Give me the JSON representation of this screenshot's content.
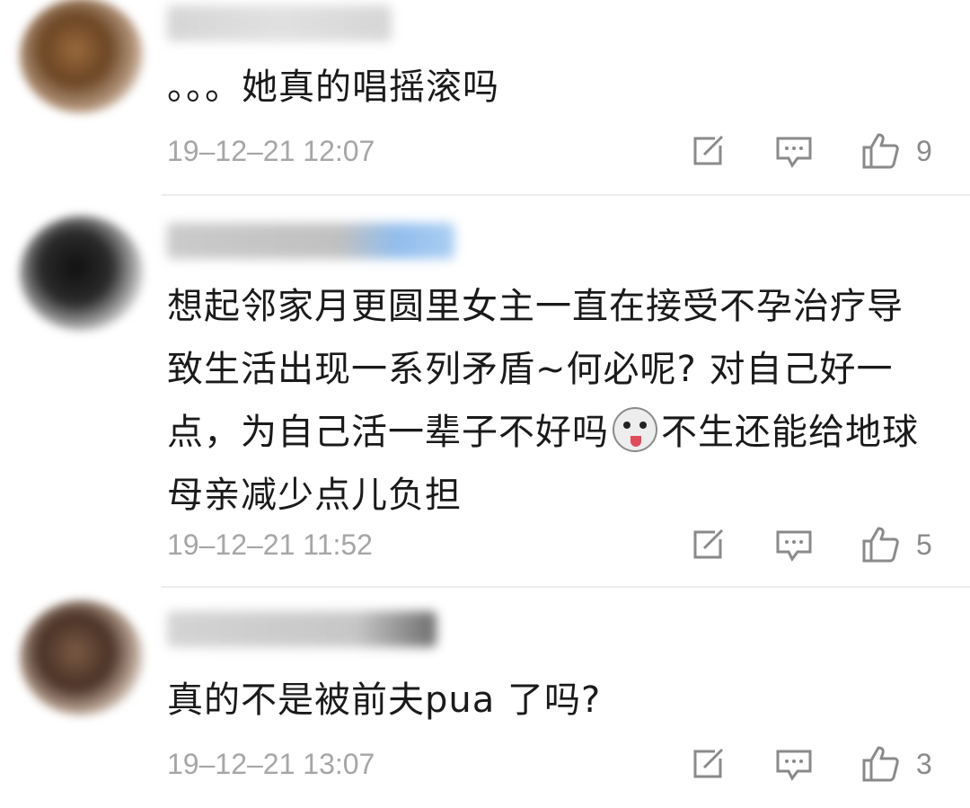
{
  "comments": [
    {
      "text": "。。。她真的唱摇滚吗",
      "time": "19–12–21 12:07",
      "likes": "9",
      "avatar_icon": "avatar-blurred-brown",
      "username_redacted": true
    },
    {
      "text_part1": "想起邻家月更圆里女主一直在接受不孕治疗导致生活出现一系列矛盾~何必呢? 对自己好一点，为自己活一辈子不好吗",
      "emoji_icon": "husky-dog-emoji-icon",
      "text_part2": "不生还能给地球母亲减少点儿负担",
      "time": "19–12–21 11:52",
      "likes": "5",
      "avatar_icon": "avatar-blurred-black",
      "username_redacted": true
    },
    {
      "text": "真的不是被前夫pua 了吗?",
      "time": "19–12–21 13:07",
      "likes": "3",
      "avatar_icon": "avatar-blurred-dark-brown",
      "username_redacted": true
    }
  ],
  "icons": {
    "share": "share-edit-icon",
    "reply": "comment-bubble-icon",
    "like": "thumbs-up-icon"
  },
  "colors": {
    "text": "#1a1a1a",
    "meta": "#a6a6a6",
    "icon": "#8a8a8a",
    "divider": "#ececec"
  }
}
